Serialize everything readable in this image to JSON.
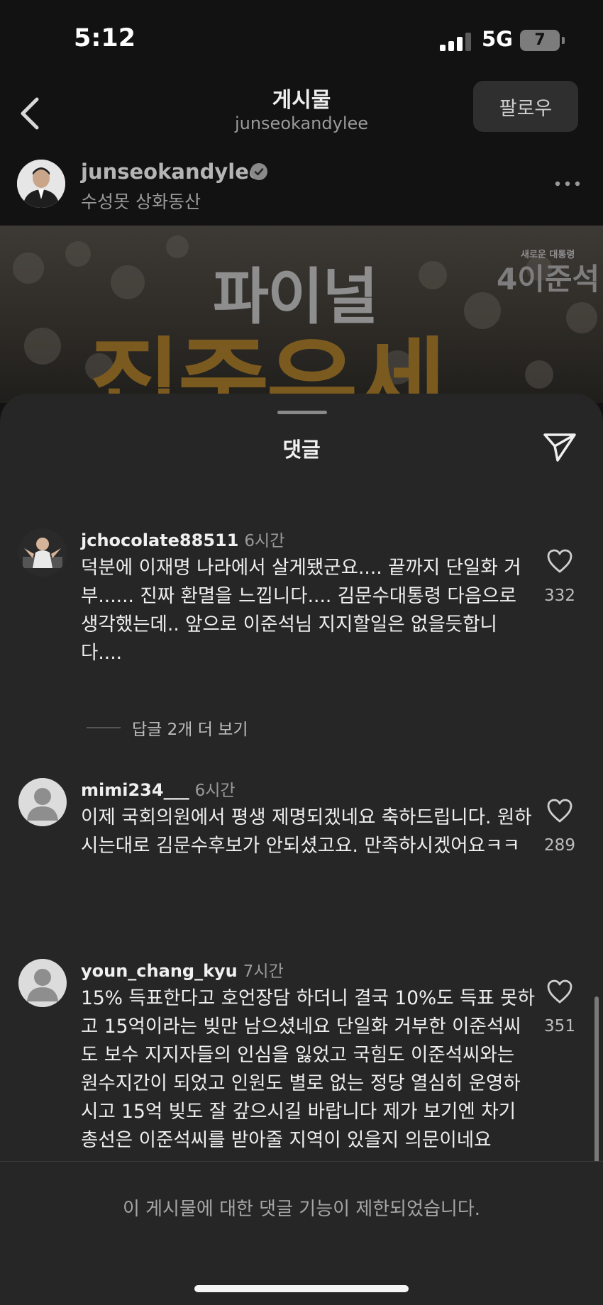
{
  "status": {
    "time": "5:12",
    "network": "5G",
    "battery": "7"
  },
  "nav": {
    "title": "게시물",
    "subtitle": "junseokandylee",
    "follow_label": "팔로우"
  },
  "post": {
    "author": "junseokandylee",
    "location": "수성못 상화동산",
    "image_text": {
      "line1": "파이널",
      "line2": "집중유세",
      "badge_small": "새로운 대통령",
      "badge_big": "4이준석"
    }
  },
  "sheet": {
    "title": "댓글"
  },
  "comments": [
    {
      "username": "jchocolate88511",
      "time": "6시간",
      "text": "덕분에 이재명 나라에서 살게됐군요.... 끝까지 단일화 거부...... 진짜 환멸을 느낍니다.... 김문수대통령 다음으로 생각했는데.. 앞으로 이준석님 지지할일은 없을듯합니다....",
      "likes": "332"
    },
    {
      "username": "mimi234___",
      "time": "6시간",
      "text": "이제 국회의원에서 평생 제명되겠네요 축하드립니다. 원하시는대로 김문수후보가 안되셨고요. 만족하시겠어요ㅋㅋ",
      "likes": "289"
    },
    {
      "username": "youn_chang_kyu",
      "time": "7시간",
      "text": "15% 득표한다고 호언장담 하더니 결국 10%도 득표 못하고 15억이라는 빚만 남으셨네요 단일화 거부한 이준석씨도 보수 지지자들의 인심을 잃었고 국힘도 이준석씨와는 원수지간이 되었고 인원도 별로 없는 정당 열심히 운영하시고 15억 빚도 잘 갚으시길 바랍니다 제가 보기엔 차기 총선은  이준석씨를 받아줄 지역이 있을지 의문이네요",
      "likes": "351"
    }
  ],
  "replies_label": "답글 2개 더 보기",
  "footer": {
    "restricted_text": "이 게시물에 대한 댓글 기능이 제한되었습니다."
  }
}
